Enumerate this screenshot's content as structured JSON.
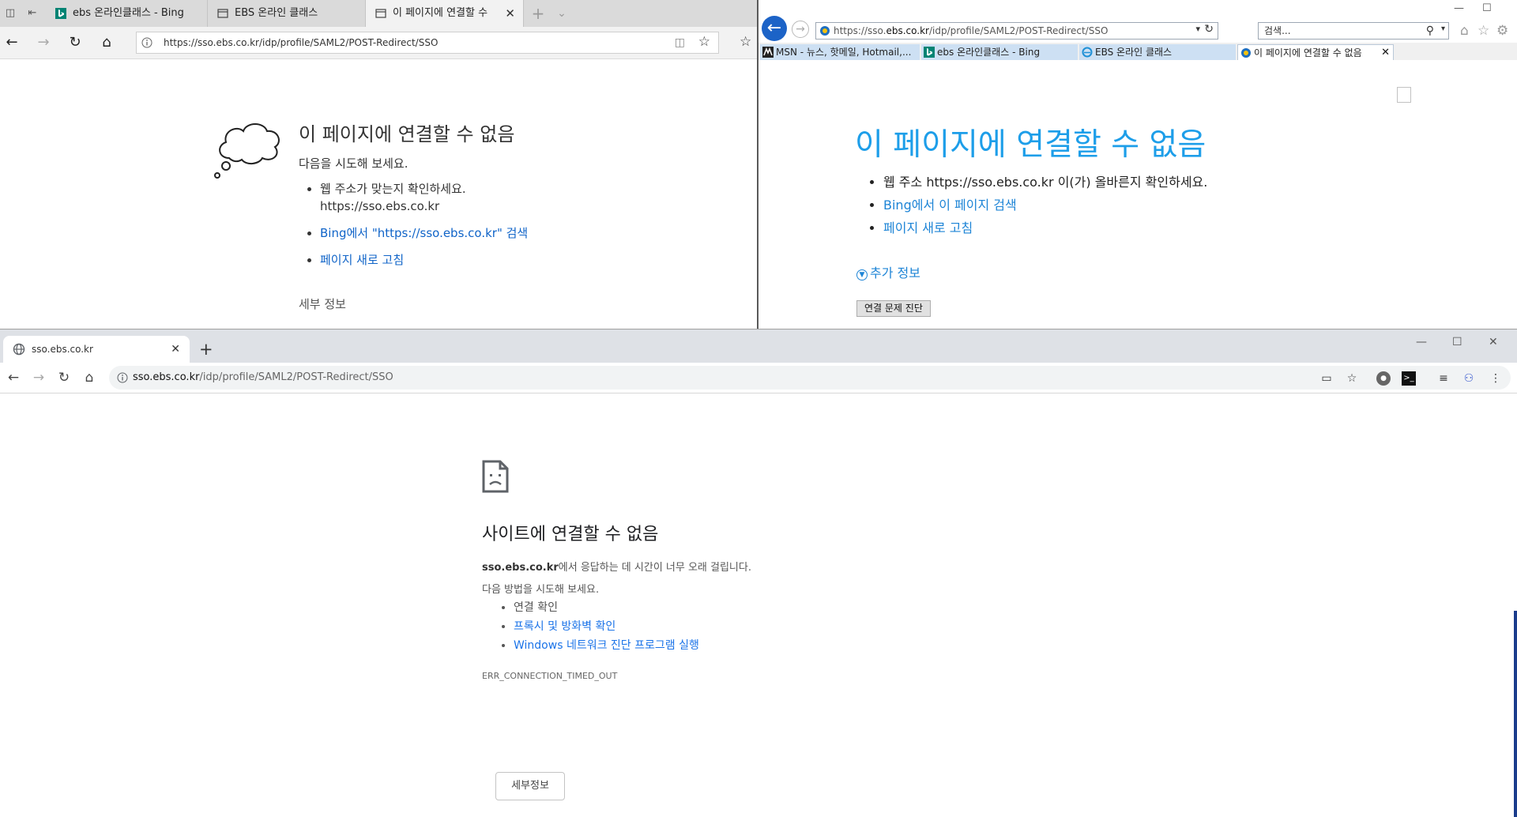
{
  "edge": {
    "tabs": [
      {
        "label": "ebs 온라인클래스 - Bing",
        "favicon": "bing-icon"
      },
      {
        "label": "EBS 온라인 클래스",
        "favicon": "page-icon"
      },
      {
        "label": "이 페이지에 연결할 수",
        "favicon": "page-icon",
        "active": true
      }
    ],
    "address": "https://sso.ebs.co.kr/idp/profile/SAML2/POST-Redirect/SSO",
    "error": {
      "title": "이 페이지에 연결할 수 없음",
      "subtitle": "다음을 시도해 보세요.",
      "item1_line1": "웹 주소가 맞는지 확인하세요.",
      "item1_line2": "https://sso.ebs.co.kr",
      "item2": "Bing에서 \"https://sso.ebs.co.kr\" 검색",
      "item3": "페이지 새로 고침",
      "details": "세부 정보"
    },
    "link_color": "#1064c8"
  },
  "ie": {
    "address_prefix": "https://sso.",
    "address_host": "ebs.co.kr",
    "address_path": "/idp/profile/SAML2/POST-Redirect/SSO",
    "search_placeholder": "검색...",
    "tabs": [
      {
        "label": "MSN - 뉴스, 핫메일, Hotmail,..."
      },
      {
        "label": "ebs 온라인클래스 - Bing"
      },
      {
        "label": "EBS 온라인 클래스"
      },
      {
        "label": "이 페이지에 연결할 수 없음",
        "active": true
      }
    ],
    "error": {
      "title": "이 페이지에 연결할 수 없음",
      "item1": "웹 주소 https://sso.ebs.co.kr 이(가) 올바른지 확인하세요.",
      "item2": "Bing에서 이 페이지 검색",
      "item3": "페이지 새로 고침",
      "more_info": "추가 정보",
      "diagnose_button": "연결 문제 진단"
    },
    "title_color": "#1d9ee9",
    "back_color": "#1c63c7"
  },
  "chrome": {
    "tab_title": "sso.ebs.co.kr",
    "address_host": "sso.ebs.co.kr",
    "address_path": "/idp/profile/SAML2/POST-Redirect/SSO",
    "error": {
      "title": "사이트에 연결할 수 없음",
      "host": "sso.ebs.co.kr",
      "desc": "에서 응답하는 데 시간이 너무 오래 걸립니다.",
      "try": "다음 방법을 시도해 보세요.",
      "item1": "연결 확인",
      "item2": "프록시 및 방화벽 확인",
      "item3": "Windows 네트워크 진단 프로그램 실행",
      "code": "ERR_CONNECTION_TIMED_OUT",
      "details_button": "세부정보"
    },
    "link_color": "#1a73e8"
  }
}
